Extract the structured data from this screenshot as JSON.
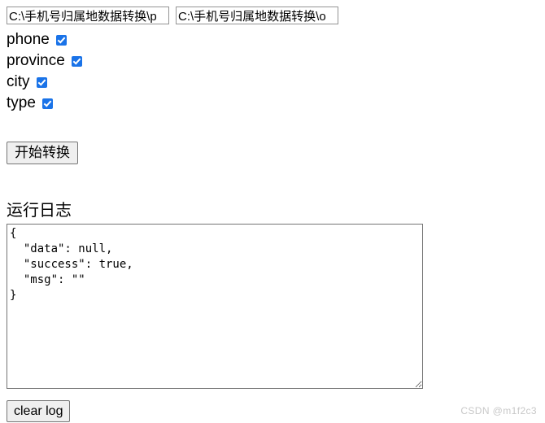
{
  "paths": {
    "input_path": {
      "name": "source-path-input",
      "value": "C:\\手机号归属地数据转换\\p",
      "placeholder": ""
    },
    "output_path": {
      "name": "output-path-input",
      "value": "C:\\手机号归属地数据转换\\o",
      "placeholder": ""
    }
  },
  "fields": [
    {
      "label": "phone",
      "checked": true
    },
    {
      "label": "province",
      "checked": true
    },
    {
      "label": "city",
      "checked": true
    },
    {
      "label": "type",
      "checked": true
    }
  ],
  "actions": {
    "start_label": "开始转换",
    "clear_label": "clear log"
  },
  "log": {
    "title": "运行日志",
    "content": "{\n  \"data\": null,\n  \"success\": true,\n  \"msg\": \"\"\n}"
  },
  "watermark": {
    "text": "CSDN @m1f2c3"
  },
  "colors": {
    "checkbox_blue": "#1a73e8",
    "button_bg": "#efefef",
    "button_border": "#767676",
    "input_border": "#949494",
    "textarea_border": "#757575",
    "watermark": "#c8c8c8"
  }
}
